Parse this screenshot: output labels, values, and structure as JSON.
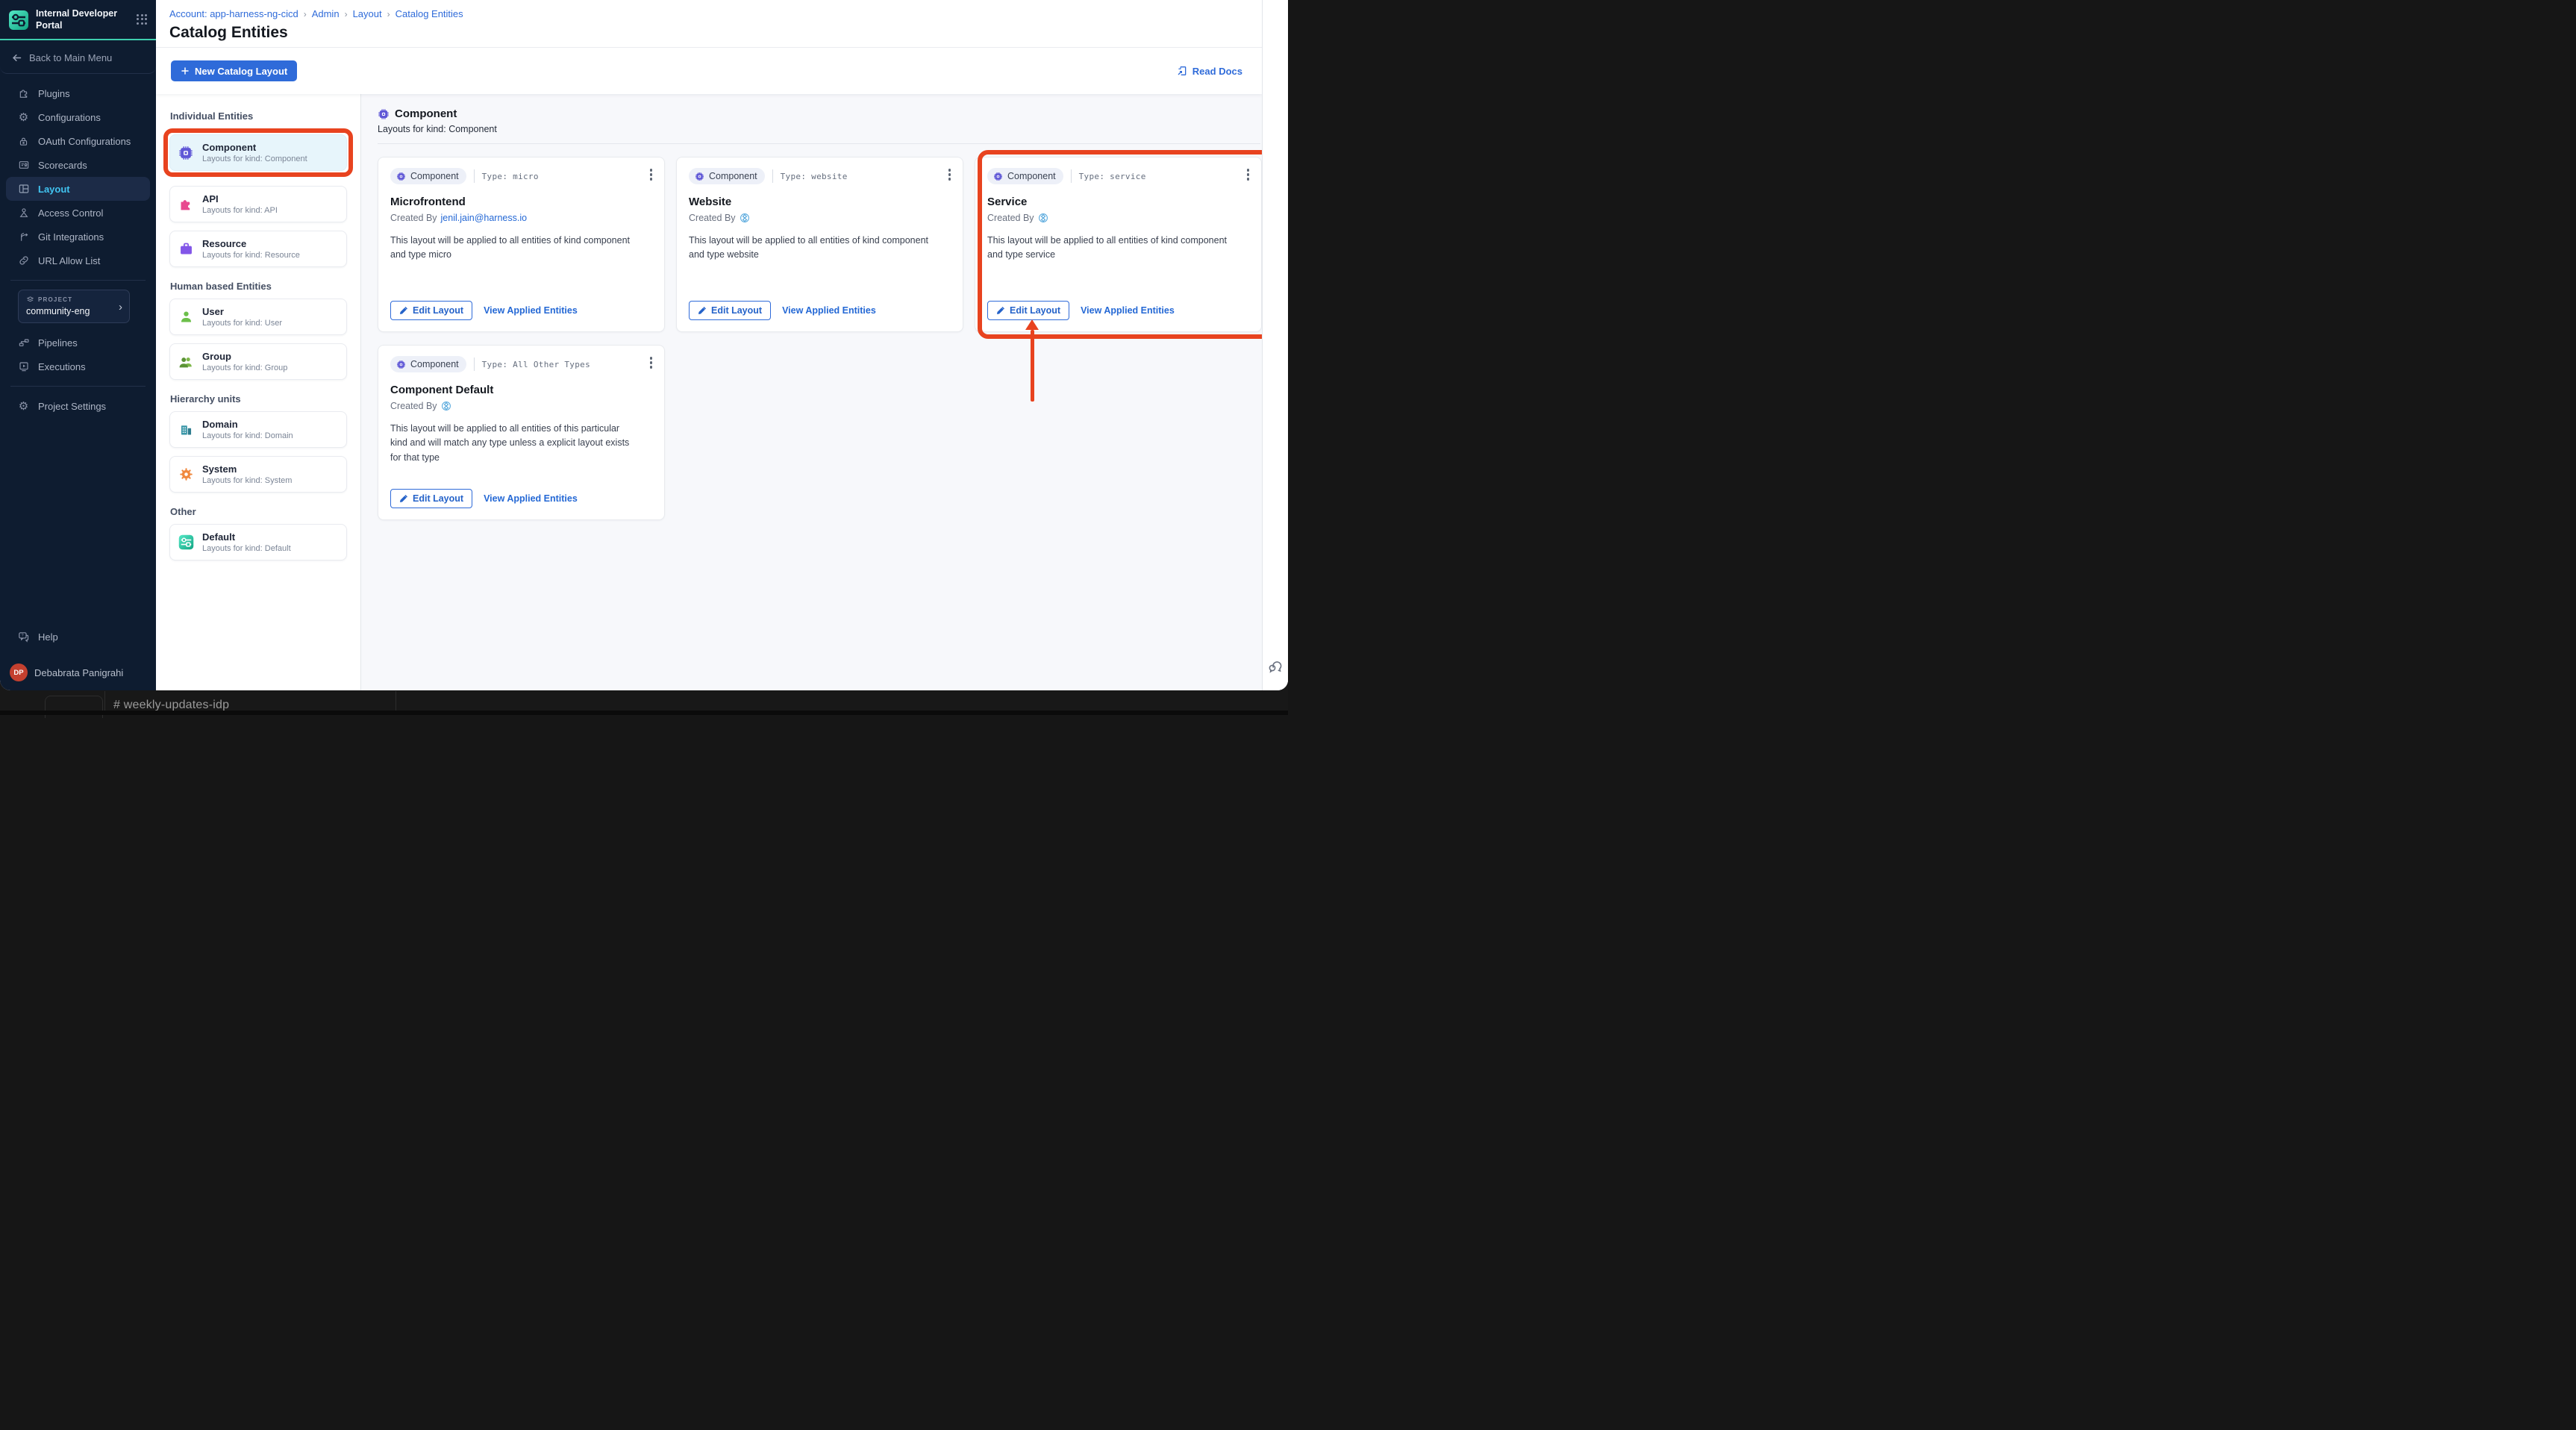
{
  "sidebar": {
    "title": "Internal Developer Portal",
    "back_label": "Back to Main Menu",
    "items": [
      {
        "label": "Plugins"
      },
      {
        "label": "Configurations"
      },
      {
        "label": "OAuth Configurations"
      },
      {
        "label": "Scorecards"
      },
      {
        "label": "Layout",
        "active": true
      },
      {
        "label": "Access Control"
      },
      {
        "label": "Git Integrations"
      },
      {
        "label": "URL Allow List"
      }
    ],
    "project": {
      "label": "PROJECT",
      "name": "community-eng"
    },
    "project_items": [
      {
        "label": "Pipelines"
      },
      {
        "label": "Executions"
      }
    ],
    "settings_label": "Project Settings",
    "help_label": "Help",
    "user": {
      "initials": "DP",
      "name": "Debabrata Panigrahi"
    }
  },
  "breadcrumb": {
    "account": "Account: app-harness-ng-cicd",
    "admin": "Admin",
    "layout": "Layout",
    "current": "Catalog Entities"
  },
  "page": {
    "title": "Catalog Entities"
  },
  "toolbar": {
    "new_layout": "New Catalog Layout",
    "read_docs": "Read Docs"
  },
  "entity_panel": {
    "sections": [
      {
        "label": "Individual Entities",
        "items": [
          {
            "title": "Component",
            "subtitle": "Layouts for kind: Component"
          },
          {
            "title": "API",
            "subtitle": "Layouts for kind: API"
          },
          {
            "title": "Resource",
            "subtitle": "Layouts for kind: Resource"
          }
        ]
      },
      {
        "label": "Human based Entities",
        "items": [
          {
            "title": "User",
            "subtitle": "Layouts for kind: User"
          },
          {
            "title": "Group",
            "subtitle": "Layouts for kind: Group"
          }
        ]
      },
      {
        "label": "Hierarchy units",
        "items": [
          {
            "title": "Domain",
            "subtitle": "Layouts for kind: Domain"
          },
          {
            "title": "System",
            "subtitle": "Layouts for kind: System"
          }
        ]
      },
      {
        "label": "Other",
        "items": [
          {
            "title": "Default",
            "subtitle": "Layouts for kind: Default"
          }
        ]
      }
    ]
  },
  "main": {
    "kind_title": "Component",
    "kind_subtitle": "Layouts for kind: Component",
    "cards": [
      {
        "badge": "Component",
        "type": "Type: micro",
        "title": "Microfrontend",
        "created_by": "Created By",
        "created_link": "jenil.jain@harness.io",
        "description": "This layout will be applied to all entities of kind component and type micro",
        "edit": "Edit Layout",
        "view": "View Applied Entities"
      },
      {
        "badge": "Component",
        "type": "Type: website",
        "title": "Website",
        "created_by": "Created By",
        "description": "This layout will be applied to all entities of kind component and type website",
        "edit": "Edit Layout",
        "view": "View Applied Entities"
      },
      {
        "badge": "Component",
        "type": "Type: service",
        "title": "Service",
        "created_by": "Created By",
        "description": "This layout will be applied to all entities of kind component and type service",
        "edit": "Edit Layout",
        "view": "View Applied Entities"
      },
      {
        "badge": "Component",
        "type": "Type: All Other Types",
        "title": "Component Default",
        "created_by": "Created By",
        "description": "This layout will be applied to all entities of this particular kind and will match any type unless a explicit layout exists for that type",
        "edit": "Edit Layout",
        "view": "View Applied Entities"
      }
    ]
  },
  "background": {
    "channel": "#  weekly-updates-idp"
  },
  "colors": {
    "annotation_red": "#E8431F",
    "accent_blue": "#2F6BD9",
    "brand_teal": "#3ECFAE",
    "sidebar_navy": "#0E1C30"
  }
}
